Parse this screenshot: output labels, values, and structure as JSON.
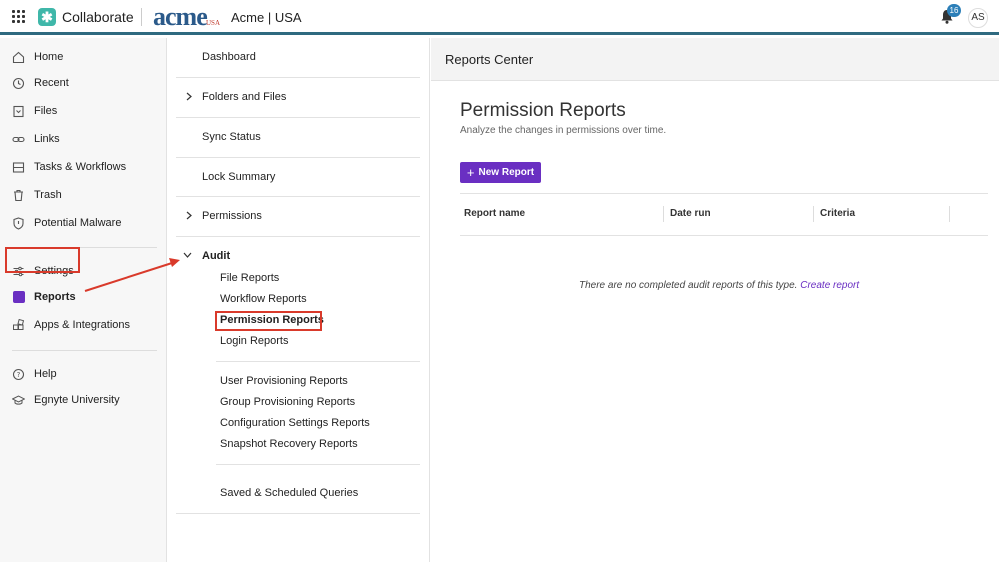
{
  "topbar": {
    "brand_name": "Collaborate",
    "acme_logo": "acme",
    "acme_usa": "USA",
    "org_name": "Acme | USA",
    "notification_count": "16",
    "avatar_initials": "AS"
  },
  "sidebar": {
    "items": [
      {
        "label": "Home",
        "icon": "home-icon"
      },
      {
        "label": "Recent",
        "icon": "clock-icon"
      },
      {
        "label": "Files",
        "icon": "file-icon"
      },
      {
        "label": "Links",
        "icon": "link-icon"
      },
      {
        "label": "Tasks & Workflows",
        "icon": "tasks-icon"
      },
      {
        "label": "Trash",
        "icon": "trash-icon"
      },
      {
        "label": "Potential Malware",
        "icon": "shield-icon"
      },
      {
        "label": "Settings",
        "icon": "sliders-icon"
      },
      {
        "label": "Reports",
        "icon": "reports-icon"
      },
      {
        "label": "Apps & Integrations",
        "icon": "apps-icon"
      },
      {
        "label": "Help",
        "icon": "help-icon"
      },
      {
        "label": "Egnyte University",
        "icon": "graduation-icon"
      }
    ]
  },
  "midpanel": {
    "dashboard": "Dashboard",
    "folders_files": "Folders and Files",
    "sync_status": "Sync Status",
    "lock_summary": "Lock Summary",
    "permissions": "Permissions",
    "audit": "Audit",
    "audit_items": [
      "File Reports",
      "Workflow Reports",
      "Permission Reports",
      "Login Reports"
    ],
    "provisioning_items": [
      "User Provisioning Reports",
      "Group Provisioning Reports",
      "Configuration Settings Reports",
      "Snapshot Recovery Reports"
    ],
    "saved_queries": "Saved & Scheduled Queries"
  },
  "content": {
    "header_title": "Reports Center",
    "page_title": "Permission Reports",
    "page_subtitle": "Analyze the changes in permissions over time.",
    "new_report_label": "New Report",
    "columns": [
      "Report name",
      "Date run",
      "Criteria"
    ],
    "empty_message": "There are no completed audit reports of this type.",
    "empty_link": "Create report"
  },
  "colors": {
    "accent": "#6a2fc2",
    "highlight_box": "#d93a2b",
    "topbar_border": "#2f6a80"
  }
}
